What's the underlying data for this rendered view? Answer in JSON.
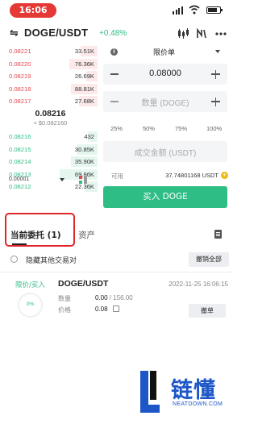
{
  "status_bar": {
    "time": "16:06"
  },
  "header": {
    "swap_icon": "⇋",
    "pair": "DOGE/USDT",
    "change": "+0.48%"
  },
  "order_book": {
    "asks": [
      {
        "price": "0.08221",
        "qty": "33.51K",
        "depth": 0.18
      },
      {
        "price": "0.08220",
        "qty": "76.36K",
        "depth": 0.3
      },
      {
        "price": "0.08219",
        "qty": "26.69K",
        "depth": 0.12
      },
      {
        "price": "0.08218",
        "qty": "88.81K",
        "depth": 0.28
      },
      {
        "price": "0.08217",
        "qty": "27.68K",
        "depth": 0.2
      }
    ],
    "last_price": "0.08216",
    "fiat_price": "≈ $0.082160",
    "bids": [
      {
        "price": "0.08216",
        "qty": "432",
        "depth": 0.1
      },
      {
        "price": "0.08215",
        "qty": "30.85K",
        "depth": 0.22
      },
      {
        "price": "0.08214",
        "qty": "35.90K",
        "depth": 0.28
      },
      {
        "price": "0.08213",
        "qty": "69.86K",
        "depth": 0.4
      },
      {
        "price": "0.08212",
        "qty": "22.36K",
        "depth": 0.14
      }
    ],
    "precision": "0.00001"
  },
  "order_form": {
    "order_type": "限价单",
    "price_value": "0.08000",
    "amount_placeholder": "数量 (DOGE)",
    "percents": [
      "25%",
      "50%",
      "75%",
      "100%"
    ],
    "total_placeholder": "成交金额 (USDT)",
    "available_label": "可用",
    "available_value": "37.74801168 USDT",
    "buy_button": "买入 DOGE"
  },
  "tabs": {
    "open_orders": "当前委托 (1)",
    "assets": "资产"
  },
  "filter": {
    "hide_other_pairs": "隐藏其他交易对",
    "cancel_all": "撤销全部"
  },
  "open_order": {
    "side": "限价/买入",
    "pair": "DOGE/USDT",
    "time": "2022-11-25 16:06:15",
    "progress": "0%",
    "amount_label": "数量",
    "amount_filled": "0.00",
    "amount_total": " / 156.00",
    "price_label": "价格",
    "price_value": "0.08",
    "cancel": "撤单"
  },
  "watermark": {
    "title": "链懂",
    "url": "NEATDOWN.COM"
  },
  "colors": {
    "buy_green": "#2ebd85",
    "sell_red": "#e0494f",
    "highlight": "#e0262b",
    "brand_blue": "#1d56c7"
  }
}
